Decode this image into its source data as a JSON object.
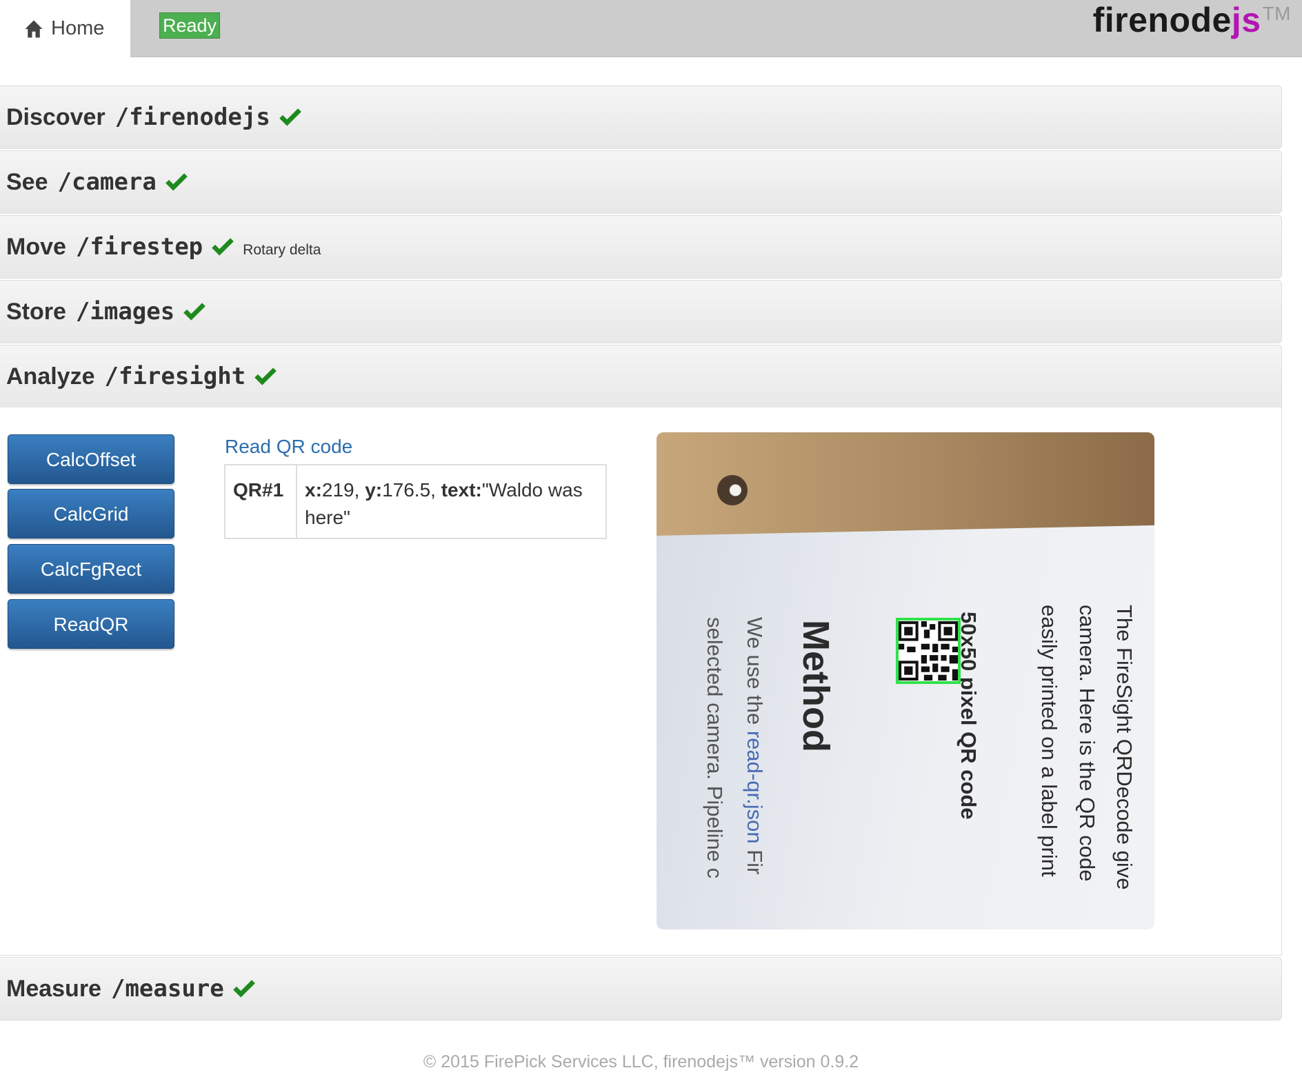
{
  "navbar": {
    "home_label": "Home",
    "status": "Ready",
    "brand_main": "firenode",
    "brand_accent": "js",
    "brand_tm": "TM",
    "brand_accent_color": "#b414b4"
  },
  "panels": [
    {
      "name": "Discover",
      "path": "/firenodejs",
      "status_icon": "check-icon"
    },
    {
      "name": "See",
      "path": "/camera",
      "status_icon": "check-icon"
    },
    {
      "name": "Move",
      "path": "/firestep",
      "status_icon": "check-icon",
      "subtitle": "Rotary delta"
    },
    {
      "name": "Store",
      "path": "/images",
      "status_icon": "check-icon"
    },
    {
      "name": "Analyze",
      "path": "/firesight",
      "status_icon": "check-icon"
    },
    {
      "name": "Measure",
      "path": "/measure",
      "status_icon": "check-icon"
    }
  ],
  "analyze": {
    "buttons": [
      "CalcOffset",
      "CalcGrid",
      "CalcFgRect",
      "ReadQR"
    ],
    "result_title": "Read QR code",
    "result_rows": [
      {
        "id": "QR#1",
        "x_label": "x:",
        "x_value": "219",
        "y_label": "y:",
        "y_value": "176.5",
        "text_label": "text:",
        "text_value": "\"Waldo was here\""
      }
    ],
    "camera_image": {
      "line1": "The FireSight QRDecode give",
      "line2": "camera. Here is the QR code",
      "line3": "easily printed on a label print",
      "caption": "50x50 pixel QR code",
      "heading": "Method",
      "para_a": "We use the ",
      "para_link": "read-qr.json",
      "para_b": " Fir",
      "para_line2": "selected camera. Pipeline c"
    }
  },
  "footer": "© 2015 FirePick Services LLC, firenodejs™ version 0.9.2",
  "colors": {
    "check": "#1e8a1e",
    "button": "#2f6ca8",
    "ready_badge": "#4caf50",
    "link": "#2a6ead",
    "qr_highlight": "#2fe24a"
  }
}
